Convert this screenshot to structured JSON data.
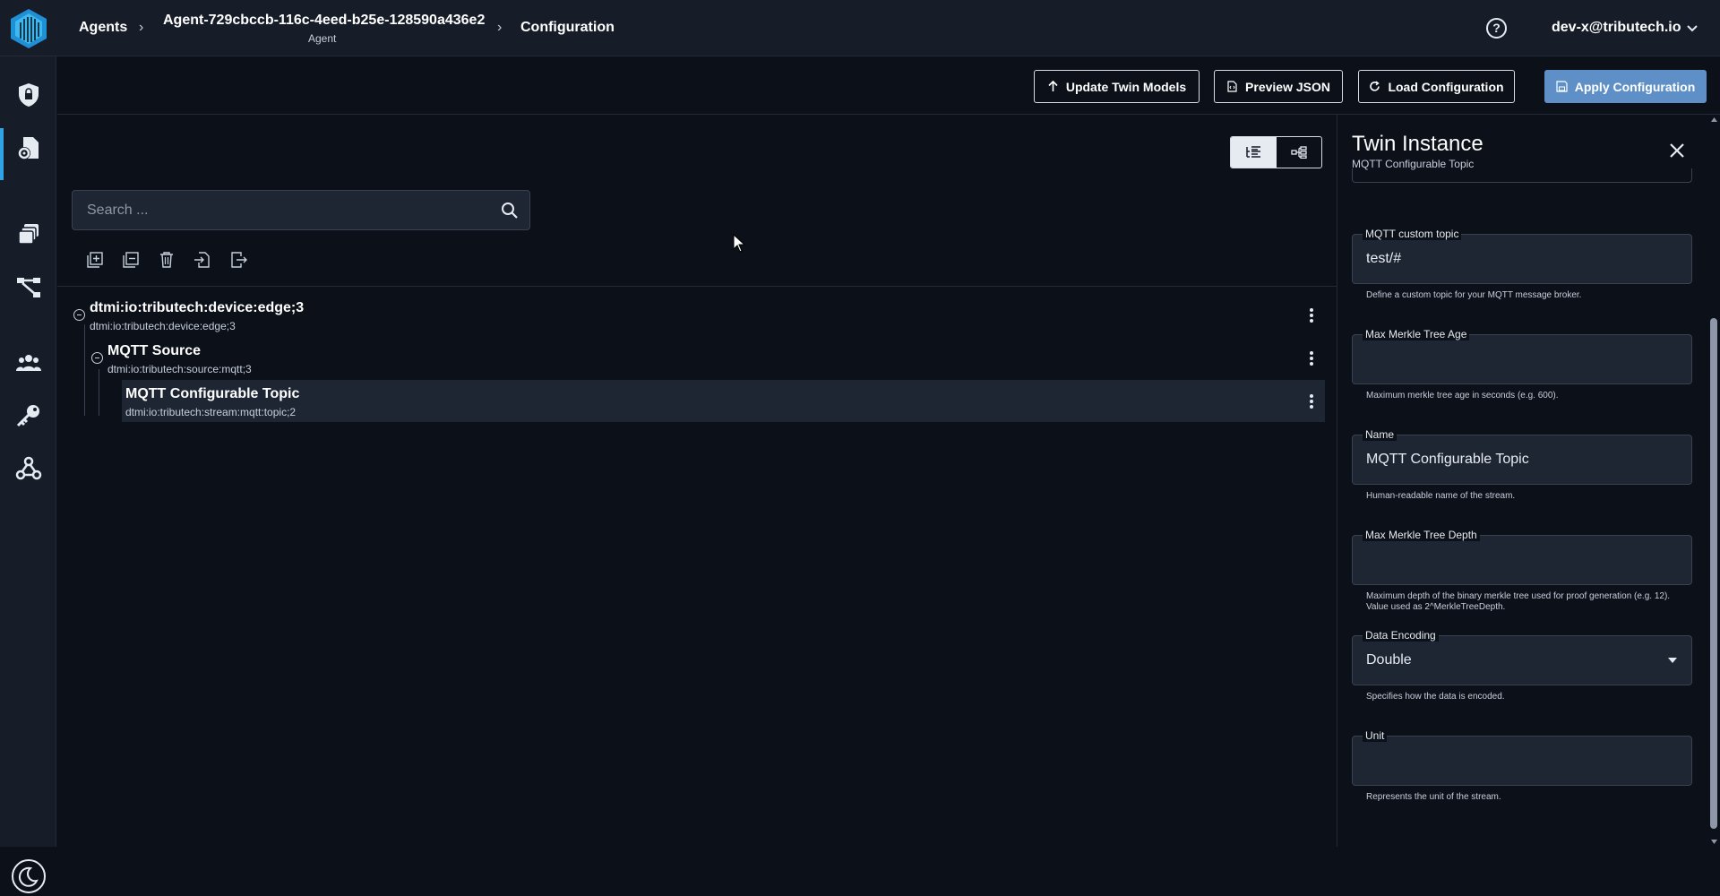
{
  "header": {
    "crumbs": [
      "Agents",
      "Agent-729cbccb-116c-4eed-b25e-128590a436e2",
      "Configuration"
    ],
    "agent_sub": "Agent",
    "help_glyph": "?",
    "user": "dev-x@tributech.io"
  },
  "toolbar": {
    "update_label": "Update Twin Models",
    "preview_label": "Preview JSON",
    "load_label": "Load Configuration",
    "apply_label": "Apply Configuration"
  },
  "search": {
    "placeholder": "Search ..."
  },
  "tree": [
    {
      "title": "dtmi:io:tributech:device:edge;3",
      "sub": "dtmi:io:tributech:device:edge;3"
    },
    {
      "title": "MQTT Source",
      "sub": "dtmi:io:tributech:source:mqtt;3"
    },
    {
      "title": "MQTT Configurable Topic",
      "sub": "dtmi:io:tributech:stream:mqtt:topic;2"
    }
  ],
  "panel": {
    "title": "Twin Instance",
    "subtitle": "MQTT Configurable Topic",
    "fields": [
      {
        "label": "MQTT custom topic",
        "value": "test/#",
        "help": "Define a custom topic for your MQTT message broker."
      },
      {
        "label": "Max Merkle Tree Age",
        "value": "",
        "help": "Maximum merkle tree age in seconds (e.g. 600)."
      },
      {
        "label": "Name",
        "value": "MQTT Configurable Topic",
        "help": "Human-readable name of the stream."
      },
      {
        "label": "Max Merkle Tree Depth",
        "value": "",
        "help": "Maximum depth of the binary merkle tree used for proof generation (e.g. 12). Value used as 2^MerkleTreeDepth."
      },
      {
        "label": "Data Encoding",
        "value": "Double",
        "help": "Specifies how the data is encoded."
      },
      {
        "label": "Unit",
        "value": "",
        "help": "Represents the unit of the stream."
      }
    ]
  },
  "colors": {
    "accent": "#2fa3e6",
    "primary_button": "#5e90c7",
    "background": "#0b1019",
    "bar": "#161d29"
  }
}
